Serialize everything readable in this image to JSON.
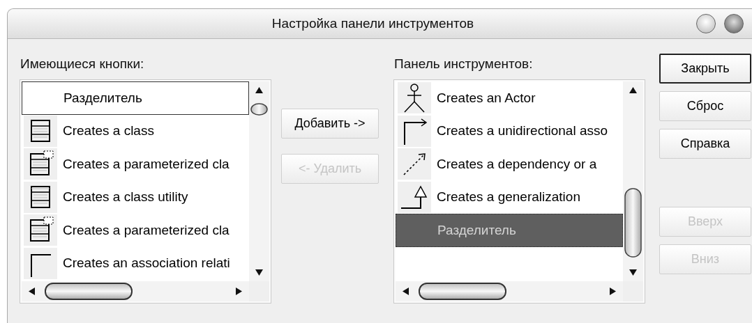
{
  "window": {
    "title": "Настройка панели инструментов"
  },
  "available": {
    "label": "Имеющиеся кнопки:",
    "items": [
      {
        "kind": "separator",
        "text": "Разделитель",
        "selected": false,
        "focused": true
      },
      {
        "kind": "class",
        "text": "Creates a class",
        "selected": false,
        "focused": false
      },
      {
        "kind": "parameterized-class",
        "text": "Creates a parameterized cla",
        "selected": false,
        "focused": false
      },
      {
        "kind": "class-utility",
        "text": "Creates a class utility",
        "selected": false,
        "focused": false
      },
      {
        "kind": "parameterized-class",
        "text": "Creates a parameterized cla",
        "selected": false,
        "focused": false
      },
      {
        "kind": "association",
        "text": "Creates an association relati",
        "selected": false,
        "focused": false
      }
    ]
  },
  "transfer_buttons": [
    {
      "label": "Добавить ->",
      "disabled": false
    },
    {
      "label": "<- Удалить",
      "disabled": true
    }
  ],
  "toolbar": {
    "label": "Панель инструментов:",
    "items": [
      {
        "kind": "actor",
        "text": "Creates an Actor",
        "selected": false,
        "focused": false
      },
      {
        "kind": "unidirectional-association",
        "text": "Creates a unidirectional asso",
        "selected": false,
        "focused": false
      },
      {
        "kind": "dependency",
        "text": "Creates a dependency or a",
        "selected": false,
        "focused": false
      },
      {
        "kind": "generalization",
        "text": "Creates a generalization",
        "selected": false,
        "focused": false
      },
      {
        "kind": "separator",
        "text": "Разделитель",
        "selected": true,
        "focused": false
      }
    ]
  },
  "side_buttons": [
    {
      "label": "Закрыть",
      "default": true,
      "disabled": false
    },
    {
      "label": "Сброс",
      "default": false,
      "disabled": false
    },
    {
      "label": "Справка",
      "default": false,
      "disabled": false
    },
    {
      "label": "Вверх",
      "default": false,
      "disabled": true
    },
    {
      "label": "Вниз",
      "default": false,
      "disabled": true
    }
  ]
}
